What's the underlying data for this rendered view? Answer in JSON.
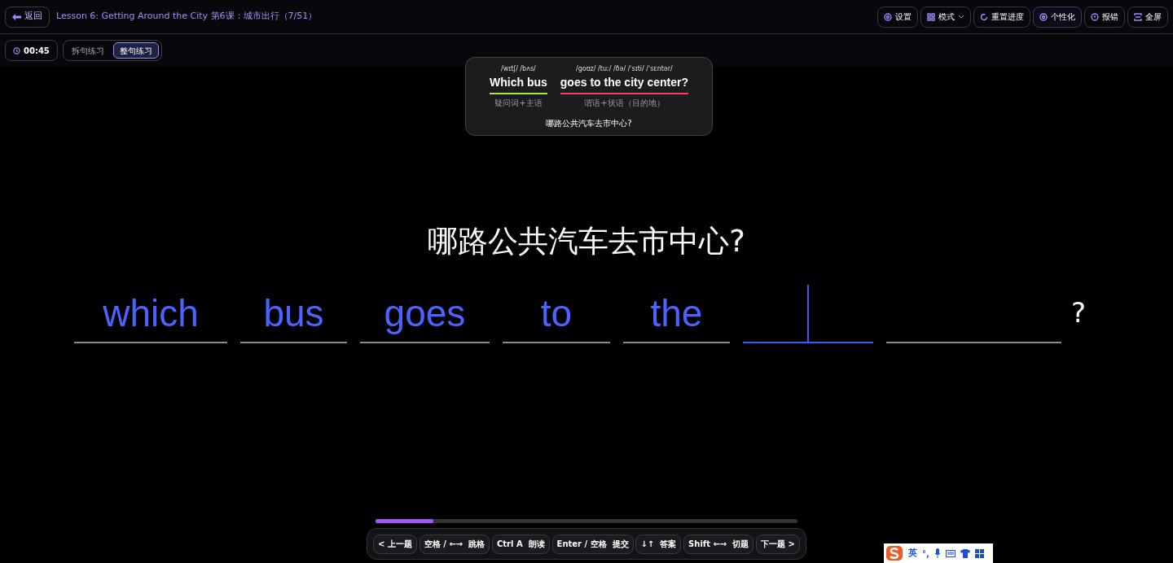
{
  "header": {
    "back": "返回",
    "title": "Lesson 6: Getting Around the City 第6课：城市出行（7/51）",
    "actions": [
      {
        "label": "设置",
        "kind": "gear",
        "caret": false,
        "selected": false
      },
      {
        "label": "模式",
        "kind": "grid",
        "caret": true,
        "selected": false
      },
      {
        "label": "重置进度",
        "kind": "reset",
        "caret": false,
        "selected": false
      },
      {
        "label": "个性化",
        "kind": "gear",
        "caret": false,
        "selected": true
      },
      {
        "label": "报错",
        "kind": "alert",
        "caret": false,
        "selected": false
      },
      {
        "label": "全屏",
        "kind": "expand",
        "caret": false,
        "selected": false
      }
    ]
  },
  "timer": "00:45",
  "modes": [
    {
      "label": "拆句练习",
      "selected": false
    },
    {
      "label": "整句练习",
      "selected": true
    }
  ],
  "hint": {
    "chunks": [
      {
        "phonetic": "/wɪtʃ/ /bʌs/",
        "text": "Which bus",
        "color": "#a3e635",
        "label": "疑问词+主语"
      },
      {
        "phonetic": "/ɡoʊz/ /tuː/ /ðə/ /ˈsɪti/ /ˈsɛntər/",
        "text": "goes to the city center?",
        "color": "#f43f5e",
        "label": "谓语+状语（目的地）"
      }
    ],
    "translation": "哪路公共汽车去市中心?"
  },
  "prompt": "哪路公共汽车去市中心?",
  "slots": [
    {
      "word": "which",
      "kind": "filled"
    },
    {
      "word": "bus",
      "kind": "filled"
    },
    {
      "word": "goes",
      "kind": "filled"
    },
    {
      "word": "to",
      "kind": "filled"
    },
    {
      "word": "the",
      "kind": "filled"
    },
    {
      "kind": "active"
    },
    {
      "kind": "empty"
    }
  ],
  "end_mark": "?",
  "progress": {
    "level": 0.137
  },
  "shortcuts": [
    "< 上一题",
    "空格 / ←→  跳格",
    "Ctrl A  朗读",
    "Enter / 空格  提交",
    "↓↑  答案",
    "Shift ←→  切题",
    "下一题 >"
  ],
  "ime": {
    "lang": "英",
    "punct": "°,"
  }
}
